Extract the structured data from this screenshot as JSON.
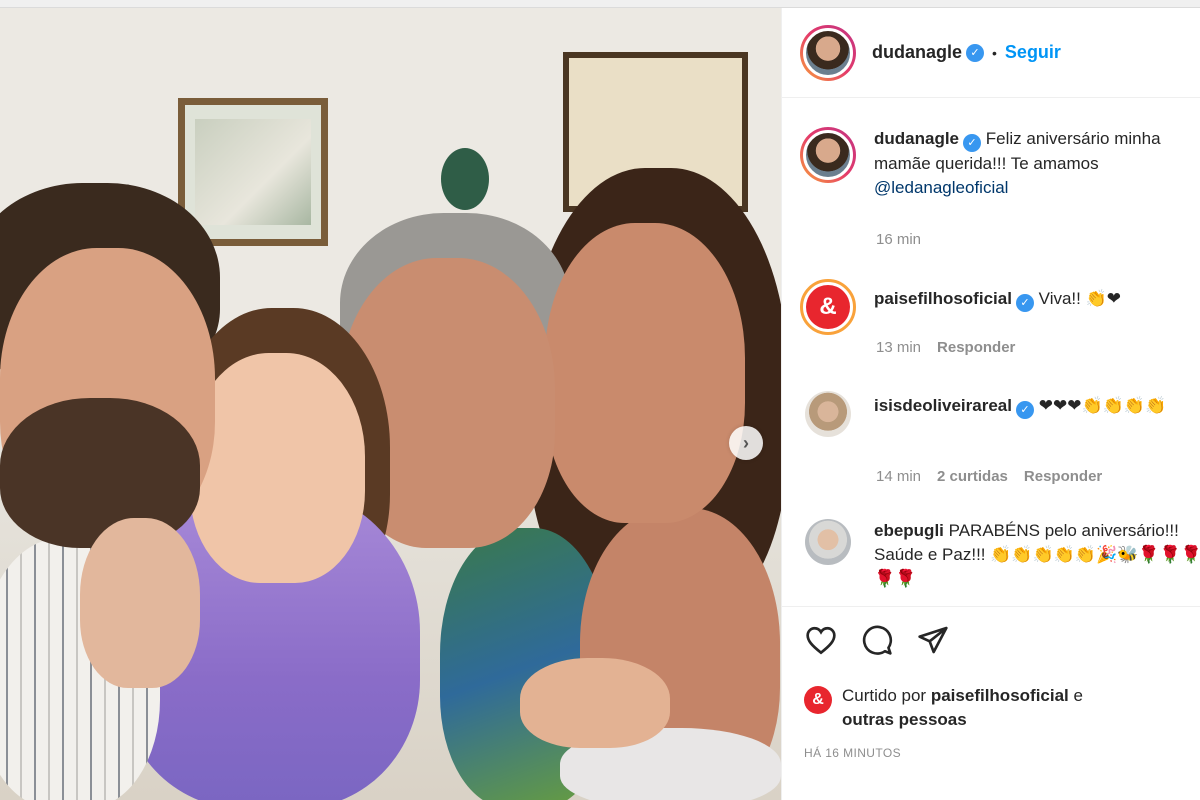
{
  "post": {
    "author": "dudanagle",
    "follow_label": "Seguir",
    "separator": "•",
    "carousel_next_label": "›"
  },
  "caption": {
    "username": "dudanagle",
    "text": "Feliz aniversário minha mamãe querida!!! Te amamos",
    "mention": "@ledanagleoficial",
    "time": "16 min"
  },
  "comments": [
    {
      "username": "paisefilhosoficial",
      "text": "Viva!!",
      "emojis": "👏❤",
      "time": "13 min",
      "likes": "",
      "reply_label": "Responder"
    },
    {
      "username": "isisdeoliveirareal",
      "text": "",
      "emojis": "❤❤❤👏👏👏👏",
      "time": "14 min",
      "likes": "2 curtidas",
      "reply_label": "Responder"
    },
    {
      "username": "ebepugli",
      "text": "PARABÉNS pelo aniversário!!! Saúde e Paz!!!",
      "emojis": "👏👏👏👏👏🎉🐝🌹🌹🌹🌹🌹",
      "time": "",
      "likes": "",
      "reply_label": ""
    }
  ],
  "likes_line": {
    "prefix": "Curtido por",
    "user": "paisefilhosoficial",
    "conj": "e",
    "rest": "outras pessoas"
  },
  "timestamp": "HÁ 16 MINUTOS",
  "badge_symbol": "&",
  "colors": {
    "link_blue": "#0095f6",
    "verified_blue": "#3897f0",
    "badge_red": "#e8262e",
    "muted": "#8e8e8e"
  }
}
